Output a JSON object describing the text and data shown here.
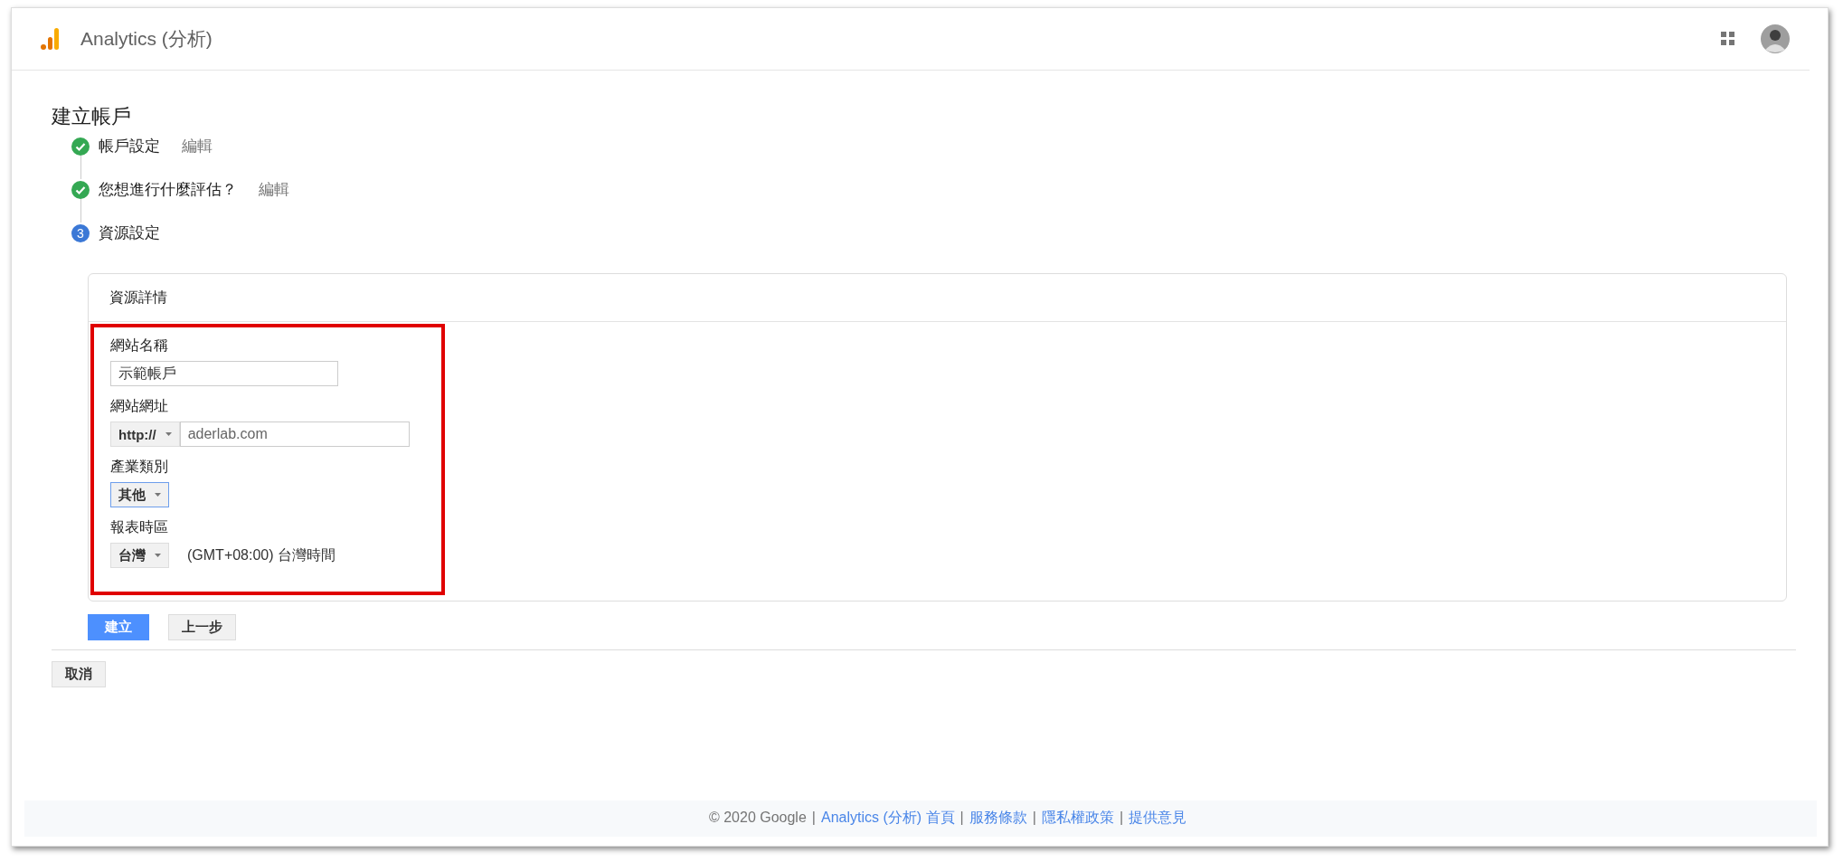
{
  "header": {
    "product": "Analytics (分析)"
  },
  "page_title": "建立帳戶",
  "steps": [
    {
      "kind": "done",
      "label": "帳戶設定",
      "edit": "編輯"
    },
    {
      "kind": "done",
      "label": "您想進行什麼評估？",
      "edit": "編輯"
    },
    {
      "kind": "current",
      "number": "3",
      "label": "資源設定"
    }
  ],
  "card": {
    "title": "資源詳情",
    "highlighted": true,
    "fields": [
      {
        "kind": "text",
        "label": "網站名稱",
        "value": "示範帳戶"
      },
      {
        "kind": "url",
        "label": "網站網址",
        "protocol": "http://",
        "value": "aderlab.com"
      },
      {
        "kind": "select",
        "label": "產業類別",
        "value": "其他",
        "focused": true
      },
      {
        "kind": "select",
        "label": "報表時區",
        "value": "台灣",
        "focused": false,
        "note": "(GMT+08:00) 台灣時間"
      }
    ]
  },
  "buttons": [
    {
      "kind": "primary",
      "label": "建立"
    },
    {
      "kind": "secondary",
      "label": "上一步"
    }
  ],
  "cancel": "取消",
  "footer": [
    {
      "kind": "text",
      "text": "© 2020 Google"
    },
    {
      "kind": "separator",
      "text": "|"
    },
    {
      "kind": "link",
      "text": "Analytics (分析) 首頁"
    },
    {
      "kind": "separator",
      "text": "|"
    },
    {
      "kind": "link",
      "text": "服務條款"
    },
    {
      "kind": "separator",
      "text": "|"
    },
    {
      "kind": "link",
      "text": "隱私權政策"
    },
    {
      "kind": "separator",
      "text": "|"
    },
    {
      "kind": "link",
      "text": "提供意見"
    }
  ]
}
